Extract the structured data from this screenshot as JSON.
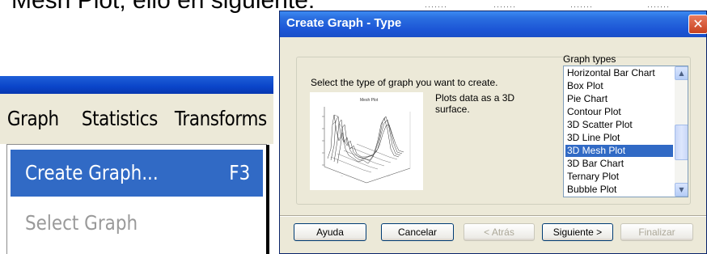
{
  "slide": {
    "caption": "Mesh Plot, ello en siguiente:"
  },
  "app": {
    "menubar": [
      "Graph",
      "Statistics",
      "Transforms"
    ],
    "graph_menu": [
      {
        "label": "Create Graph...",
        "shortcut": "F3"
      },
      {
        "label": "Select Graph",
        "shortcut": ""
      }
    ]
  },
  "dialog": {
    "title": "Create Graph - Type",
    "prompt": "Select the type of graph you want to create.",
    "description": "Plots data as a 3D surface.",
    "graph_types_label": "Graph types",
    "graph_types": [
      "Horizontal Bar Chart",
      "Box Plot",
      "Pie Chart",
      "Contour Plot",
      "3D Scatter Plot",
      "3D Line Plot",
      "3D Mesh Plot",
      "3D Bar Chart",
      "Ternary Plot",
      "Bubble Plot"
    ],
    "selected_type": "3D Mesh Plot",
    "preview_title": "Mesh Plot",
    "buttons": {
      "help": "Ayuda",
      "cancel": "Cancelar",
      "back": "< Atrás",
      "next": "Siguiente >",
      "finish": "Finalizar"
    }
  },
  "icons": {
    "close": "close-icon",
    "scroll_up": "scroll-up-arrow-icon",
    "scroll_down": "scroll-down-arrow-icon"
  },
  "colors": {
    "selection": "#316ac5",
    "title_bar": "#1c56d6",
    "dialog_face": "#ece9d8"
  }
}
